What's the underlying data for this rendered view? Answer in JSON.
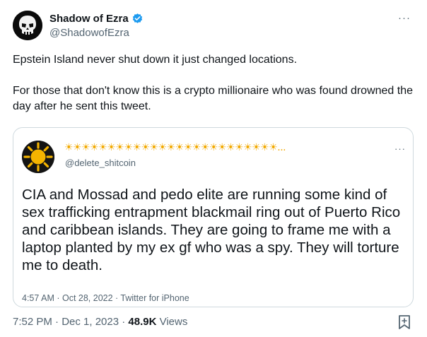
{
  "author": {
    "display_name": "Shadow of Ezra",
    "handle": "@ShadowofEzra",
    "avatar_icon": "skull-icon",
    "verified_icon": "verified-badge-icon"
  },
  "tweet": {
    "paragraph_1": "Epstein Island never shut down it just changed locations.",
    "paragraph_2": "For those that don't know this is a crypto millionaire who was found drowned the day after he sent this tweet."
  },
  "quoted": {
    "display_name": "☀☀☀☀☀☀☀☀☀☀☀☀☀☀☀☀☀☀☀☀☀☀☀☀☀...",
    "handle": "@delete_shitcoin",
    "avatar_icon": "sun-icon",
    "text": "CIA and Mossad and pedo elite are running some kind of sex trafficking entrapment blackmail ring out of Puerto Rico and caribbean islands. They are going to frame me with a laptop planted by my ex gf who was a spy. They will torture me to death.",
    "meta": "4:57 AM · Oct 28, 2022 · Twitter for iPhone"
  },
  "meta": {
    "time_date": "7:52 PM · Dec 1, 2023 · ",
    "views_count": "48.9K",
    "views_label": " Views"
  },
  "menu_glyph": "···",
  "colors": {
    "verified": "#1d9bf0",
    "secondary_text": "#536471",
    "border": "#cfd9de"
  }
}
